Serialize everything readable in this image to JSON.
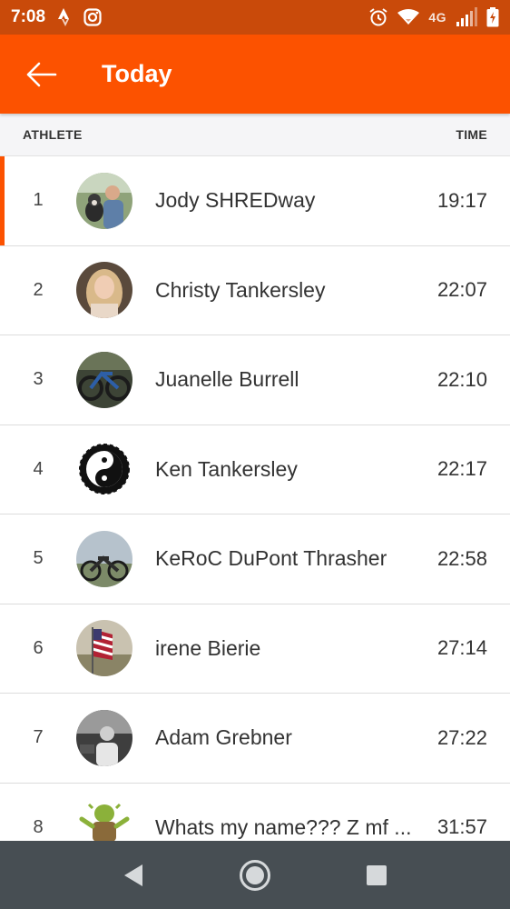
{
  "status_bar": {
    "time": "7:08",
    "network": "4G",
    "left_icons": [
      "strava-icon",
      "instagram-icon"
    ],
    "right_icons": [
      "alarm-icon",
      "wifi-icon",
      "signal-icon",
      "battery-icon"
    ]
  },
  "header": {
    "title": "Today",
    "accent": "#fc5200"
  },
  "columns": {
    "athlete": "ATHLETE",
    "time": "TIME"
  },
  "leaderboard": [
    {
      "rank": "1",
      "name": "Jody SHREDway",
      "time": "19:17",
      "highlight": true,
      "avatar": "man-with-dog-photo"
    },
    {
      "rank": "2",
      "name": "Christy Tankersley",
      "time": "22:07",
      "highlight": false,
      "avatar": "woman-selfie-photo"
    },
    {
      "rank": "3",
      "name": "Juanelle Burrell",
      "time": "22:10",
      "highlight": false,
      "avatar": "bike-photo"
    },
    {
      "rank": "4",
      "name": "Ken Tankersley",
      "time": "22:17",
      "highlight": false,
      "avatar": "yin-yang-gear-logo"
    },
    {
      "rank": "5",
      "name": "KeRoC DuPont Thrasher",
      "time": "22:58",
      "highlight": false,
      "avatar": "mountain-bike-photo"
    },
    {
      "rank": "6",
      "name": "irene Bierie",
      "time": "27:14",
      "highlight": false,
      "avatar": "american-flag-photo"
    },
    {
      "rank": "7",
      "name": "Adam Grebner",
      "time": "27:22",
      "highlight": false,
      "avatar": "man-bw-photo"
    },
    {
      "rank": "8",
      "name": "Whats my name??? Z mf ...",
      "time": "31:57",
      "highlight": false,
      "avatar": "shrek-figure"
    }
  ],
  "nav": [
    "back-nav-icon",
    "home-nav-icon",
    "recents-nav-icon"
  ]
}
